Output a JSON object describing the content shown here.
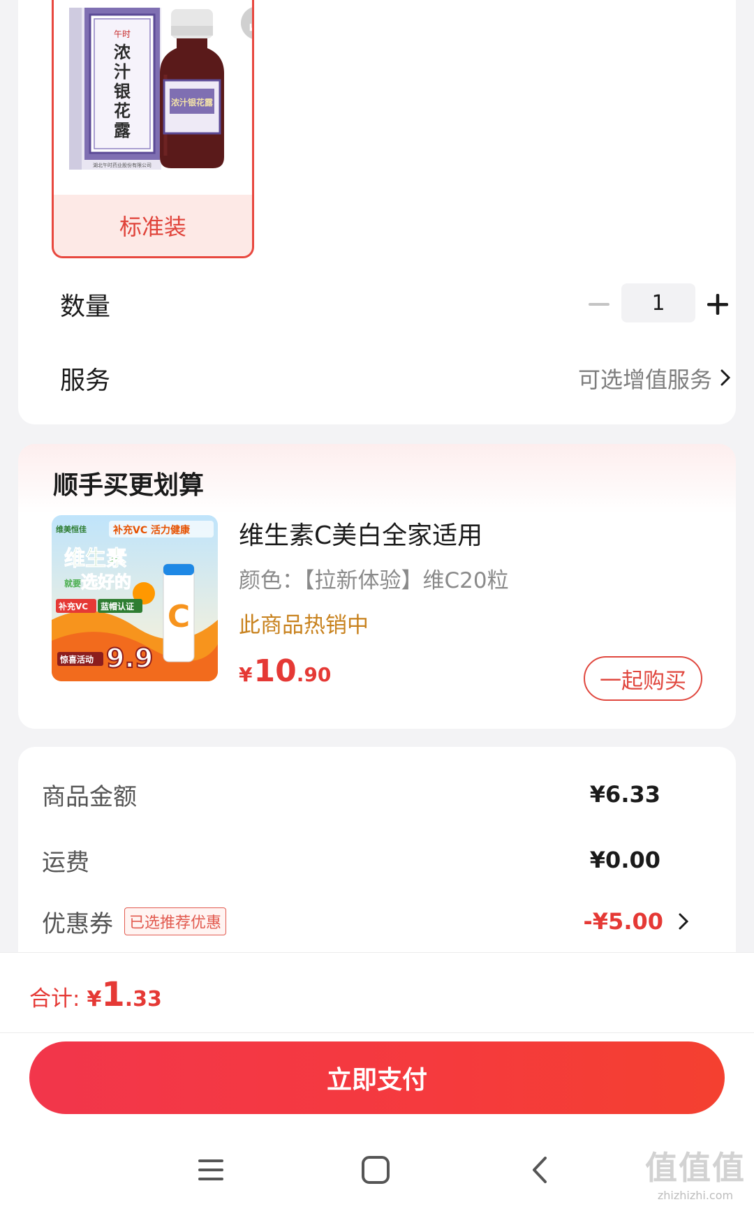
{
  "spec": {
    "label": "标准装",
    "product_image": "liquid-honeysuckle-box-and-bottle",
    "box_text": "浓汁银花露",
    "box_brand": "午时",
    "bottle_text": "浓汁银花露",
    "maker_text": "湖北午时药业股份有限公司"
  },
  "quantity": {
    "label": "数量",
    "value": "1"
  },
  "service": {
    "label": "服务",
    "hint": "可选增值服务"
  },
  "recommend": {
    "title": "顺手买更划算",
    "product_name": "维生素C美白全家适用",
    "color": "颜色：【拉新体验】维C20粒",
    "hot": "此商品热销中",
    "price": {
      "symbol": "¥",
      "integer": "10",
      "decimal": ".90"
    },
    "buy_button": "一起购买",
    "image_texts": {
      "brand": "维美恒佳",
      "slogan": "补充VC 活力健康",
      "big1": "维生素",
      "big2": "就要",
      "big3": "选好的",
      "badge1": "补充VC",
      "badge2": "蓝帽认证",
      "promo": "惊喜活动",
      "promo_price": "9.9"
    }
  },
  "summary": {
    "goods_label": "商品金额",
    "goods_value": "¥6.33",
    "shipping_label": "运费",
    "shipping_value": "¥0.00",
    "coupon_label": "优惠券",
    "coupon_tag": "已选推荐优惠",
    "coupon_value": "-¥5.00"
  },
  "total": {
    "label": "合计:",
    "symbol": "¥",
    "integer": "1",
    "decimal": ".33"
  },
  "pay_button": "立即支付",
  "nav": {
    "menu": "menu-icon",
    "home": "home-icon",
    "back": "back-icon"
  },
  "watermark": {
    "main": "值值值",
    "sub": "zhizhizhi.com"
  },
  "colors": {
    "accent": "#e53935",
    "hot": "#c8821e",
    "pay_button": "#f53a3d"
  }
}
